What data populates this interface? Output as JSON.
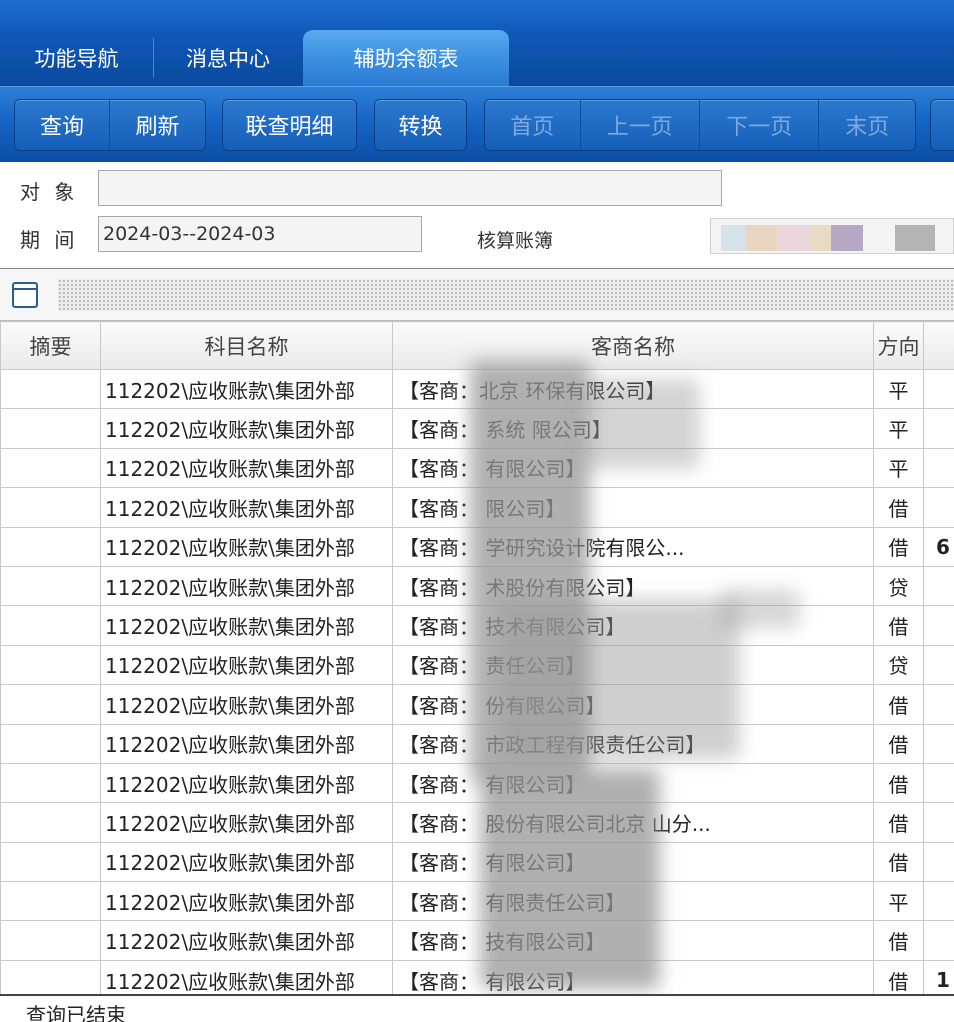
{
  "tabs": [
    {
      "label": "功能导航"
    },
    {
      "label": "消息中心"
    },
    {
      "label": "辅助余额表"
    }
  ],
  "toolbar": {
    "query": "查询",
    "refresh": "刷新",
    "drilldown": "联查明细",
    "convert": "转换",
    "first_page": "首页",
    "prev_page": "上一页",
    "next_page": "下一页",
    "last_page": "末页"
  },
  "form": {
    "object_label": "对 象",
    "object_value": "",
    "period_label": "期 间",
    "period_value": "2024-03--2024-03",
    "ledger_label": "核算账簿"
  },
  "grid": {
    "columns": [
      "摘要",
      "科目名称",
      "客商名称",
      "方向"
    ],
    "rows": [
      {
        "subject": "112202\\应收账款\\集团外部",
        "customer": "【客商：北京 环保有限公司】",
        "direction": "平",
        "extra": ""
      },
      {
        "subject": "112202\\应收账款\\集团外部",
        "customer": "【客商：  系统 限公司】",
        "direction": "平",
        "extra": ""
      },
      {
        "subject": "112202\\应收账款\\集团外部",
        "customer": "【客商：  有限公司】",
        "direction": "平",
        "extra": ""
      },
      {
        "subject": "112202\\应收账款\\集团外部",
        "customer": "【客商：  限公司】",
        "direction": "借",
        "extra": ""
      },
      {
        "subject": "112202\\应收账款\\集团外部",
        "customer": "【客商：  学研究设计院有限公...",
        "direction": "借",
        "extra": "6"
      },
      {
        "subject": "112202\\应收账款\\集团外部",
        "customer": "【客商：  术股份有限公司】",
        "direction": "贷",
        "extra": ""
      },
      {
        "subject": "112202\\应收账款\\集团外部",
        "customer": "【客商：  技术有限公司】",
        "direction": "借",
        "extra": ""
      },
      {
        "subject": "112202\\应收账款\\集团外部",
        "customer": "【客商：  责任公司】",
        "direction": "贷",
        "extra": ""
      },
      {
        "subject": "112202\\应收账款\\集团外部",
        "customer": "【客商：  份有限公司】",
        "direction": "借",
        "extra": ""
      },
      {
        "subject": "112202\\应收账款\\集团外部",
        "customer": "【客商：  市政工程有限责任公司】",
        "direction": "借",
        "extra": ""
      },
      {
        "subject": "112202\\应收账款\\集团外部",
        "customer": "【客商：  有限公司】",
        "direction": "借",
        "extra": ""
      },
      {
        "subject": "112202\\应收账款\\集团外部",
        "customer": "【客商：  股份有限公司北京 山分...",
        "direction": "借",
        "extra": ""
      },
      {
        "subject": "112202\\应收账款\\集团外部",
        "customer": "【客商：  有限公司】",
        "direction": "借",
        "extra": ""
      },
      {
        "subject": "112202\\应收账款\\集团外部",
        "customer": "【客商：  有限责任公司】",
        "direction": "平",
        "extra": ""
      },
      {
        "subject": "112202\\应收账款\\集团外部",
        "customer": "【客商：  技有限公司】",
        "direction": "借",
        "extra": ""
      },
      {
        "subject": "112202\\应收账款\\集团外部",
        "customer": "【客商：  有限公司】",
        "direction": "借",
        "extra": "1"
      }
    ]
  },
  "status": {
    "text": "查询已结束"
  },
  "colors": {
    "tab_bar": "#0f58b8",
    "active_tab": "#3a8ee0",
    "toolbar": "#1462c2"
  }
}
